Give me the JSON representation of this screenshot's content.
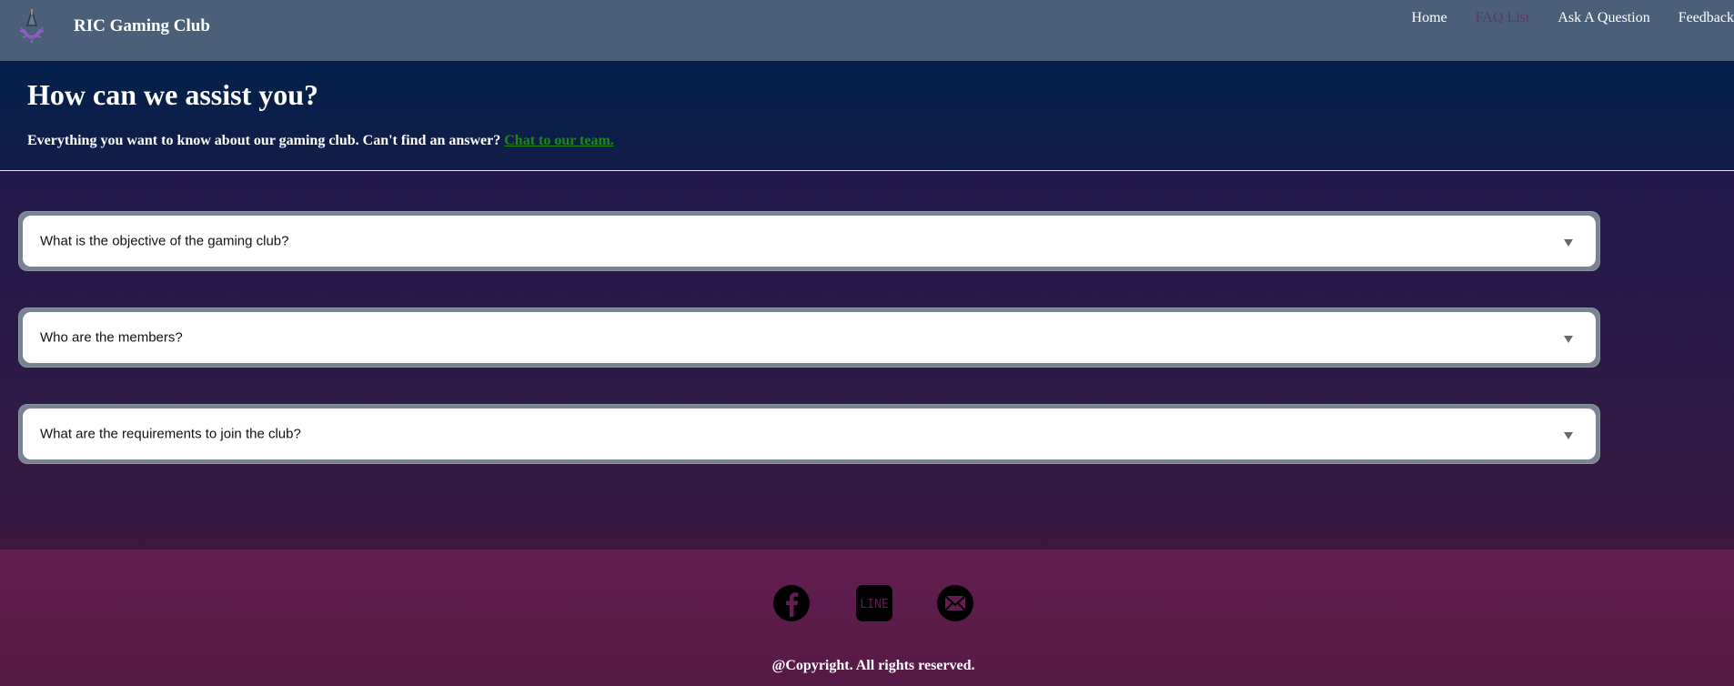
{
  "header": {
    "brand": "RIC Gaming Club",
    "nav": [
      {
        "label": "Home",
        "active": false
      },
      {
        "label": "FAQ List",
        "active": true
      },
      {
        "label": "Ask A Question",
        "active": false
      },
      {
        "label": "Feedback",
        "active": false
      }
    ]
  },
  "hero": {
    "title": "How can we assist you?",
    "subtitle": "Everything you want to know about our gaming club. Can't find an answer? ",
    "link_text": "Chat to our team."
  },
  "faq": [
    {
      "question": "What is the objective of the gaming club?",
      "icon": "chevron-down-icon"
    },
    {
      "question": "Who are the members?",
      "icon": "chevron-down-icon"
    },
    {
      "question": "What are the requirements to join the club?",
      "icon": "chevron-down-icon"
    }
  ],
  "footer": {
    "social": [
      {
        "name": "facebook-icon"
      },
      {
        "name": "line-icon",
        "text": "LINE"
      },
      {
        "name": "mail-icon"
      }
    ],
    "copyright": "@Copyright. All rights reserved."
  },
  "colors": {
    "navbar": "#4a6078",
    "active_nav": "#5a3a6a",
    "link": "#1a8a1a",
    "footer": "#621e50"
  }
}
